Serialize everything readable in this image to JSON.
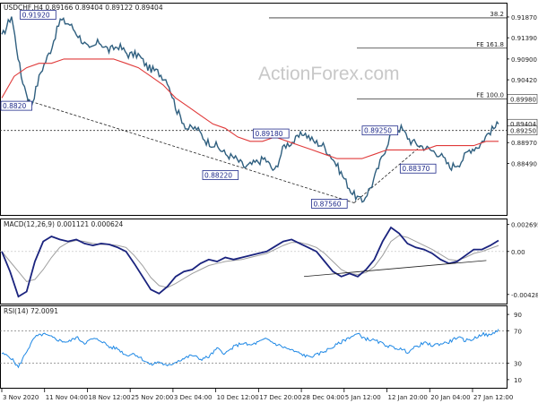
{
  "chart_data": [
    {
      "type": "candlestick",
      "header": "USDCHF,H4  0.89166 0.89404 0.89122 0.89404",
      "watermark": "ActionForex.com",
      "ylim": [
        0.873,
        0.922
      ],
      "yticks": [
        "0.91870",
        "0.91390",
        "0.90900",
        "0.90420",
        "0.89940",
        "0.89460",
        "0.88970",
        "0.88490"
      ],
      "ytick_values": [
        0.9187,
        0.9139,
        0.909,
        0.9042,
        0.8994,
        0.8946,
        0.8897,
        0.8849
      ],
      "hlines": [
        {
          "label": "38.2",
          "value": 0.9185
        },
        {
          "label": "FE 161.8",
          "value": 0.9115
        },
        {
          "label": "FE 100.0",
          "value": 0.8998,
          "tag": "0.89980"
        },
        {
          "label": "",
          "value": 0.8925,
          "tag": "0.89250",
          "dashed": true
        }
      ],
      "last_price_tag": "0.89404",
      "price_labels": [
        {
          "text": "0.91920",
          "x": 0.04,
          "y": 0.9192
        },
        {
          "text": "0.8820",
          "x": 0.0,
          "y": 0.8982
        },
        {
          "text": "0.89180",
          "x": 0.5,
          "y": 0.8918
        },
        {
          "text": "0.88220",
          "x": 0.4,
          "y": 0.8822
        },
        {
          "text": "0.89250",
          "x": 0.715,
          "y": 0.8925
        },
        {
          "text": "0.88370",
          "x": 0.79,
          "y": 0.8837
        },
        {
          "text": "0.87560",
          "x": 0.615,
          "y": 0.8756
        }
      ],
      "price_path": [
        0.914,
        0.919,
        0.905,
        0.898,
        0.906,
        0.911,
        0.918,
        0.917,
        0.914,
        0.911,
        0.913,
        0.911,
        0.912,
        0.91,
        0.91,
        0.907,
        0.906,
        0.904,
        0.897,
        0.893,
        0.893,
        0.89,
        0.889,
        0.887,
        0.886,
        0.884,
        0.885,
        0.886,
        0.883,
        0.889,
        0.89,
        0.892,
        0.89,
        0.889,
        0.886,
        0.882,
        0.878,
        0.876,
        0.88,
        0.886,
        0.892,
        0.893,
        0.89,
        0.889,
        0.888,
        0.887,
        0.884,
        0.885,
        0.888,
        0.889,
        0.892,
        0.894
      ],
      "ma_path": [
        0.9,
        0.905,
        0.907,
        0.908,
        0.908,
        0.909,
        0.909,
        0.909,
        0.909,
        0.909,
        0.908,
        0.907,
        0.905,
        0.903,
        0.9,
        0.898,
        0.896,
        0.894,
        0.893,
        0.891,
        0.89,
        0.89,
        0.891,
        0.89,
        0.889,
        0.888,
        0.887,
        0.886,
        0.886,
        0.886,
        0.887,
        0.888,
        0.888,
        0.888,
        0.888,
        0.889,
        0.889,
        0.889,
        0.889,
        0.89,
        0.89
      ]
    },
    {
      "type": "line",
      "header": "MACD(12,26,9) 0.001121 0.000624",
      "ylim": [
        -0.0052,
        0.0032
      ],
      "yticks": [
        "0.002695",
        "0.00",
        "-0.004289"
      ],
      "ytick_values": [
        0.002695,
        0.0,
        -0.004289
      ],
      "series": [
        {
          "values": [
            0.0,
            -0.002,
            -0.0045,
            -0.004,
            -0.001,
            0.001,
            0.0015,
            0.0012,
            0.001,
            0.0012,
            0.0008,
            0.0006,
            0.0008,
            0.0007,
            0.0004,
            0.0,
            -0.0012,
            -0.0025,
            -0.0038,
            -0.0042,
            -0.0035,
            -0.0025,
            -0.002,
            -0.0018,
            -0.0012,
            -0.0008,
            -0.001,
            -0.0006,
            -0.0008,
            -0.0006,
            -0.0004,
            -0.0002,
            0.0,
            0.0005,
            0.001,
            0.0012,
            0.0008,
            0.0004,
            0.0,
            -0.001,
            -0.002,
            -0.0025,
            -0.0022,
            -0.0025,
            -0.0018,
            -0.0008,
            0.001,
            0.0024,
            0.0018,
            0.0008,
            0.0004,
            0.0002,
            -0.0002,
            -0.0008,
            -0.0012,
            -0.001,
            -0.0004,
            0.0002,
            0.0002,
            0.0006,
            0.0011
          ]
        },
        {
          "values": [
            0.0,
            -0.001,
            -0.002,
            -0.003,
            -0.0028,
            -0.0018,
            -0.0006,
            0.0004,
            0.0009,
            0.0011,
            0.001,
            0.0008,
            0.0007,
            0.0007,
            0.0006,
            0.0004,
            -0.0004,
            -0.0014,
            -0.0026,
            -0.0034,
            -0.0036,
            -0.0032,
            -0.0027,
            -0.0022,
            -0.0018,
            -0.0014,
            -0.0012,
            -0.001,
            -0.0009,
            -0.0008,
            -0.0006,
            -0.0004,
            -0.0002,
            0.0002,
            0.0006,
            0.0009,
            0.0009,
            0.0007,
            0.0004,
            -0.0002,
            -0.001,
            -0.0018,
            -0.0022,
            -0.0023,
            -0.0021,
            -0.0015,
            -0.0004,
            0.001,
            0.0016,
            0.0014,
            0.001,
            0.0006,
            0.0002,
            -0.0003,
            -0.0008,
            -0.0009,
            -0.0006,
            -0.0002,
            0.0,
            0.0003,
            0.0006
          ]
        }
      ],
      "trendline": {
        "x": [
          0.6,
          0.96
        ],
        "y": [
          -0.0025,
          -0.0009
        ]
      }
    },
    {
      "type": "line",
      "header": "RSI(14) 72.0091",
      "ylim": [
        0,
        100
      ],
      "yticks": [
        "90",
        "70",
        "30",
        "10"
      ],
      "ytick_values": [
        90,
        70,
        30,
        10
      ],
      "series": [
        {
          "values": [
            42,
            38,
            25,
            45,
            62,
            66,
            62,
            58,
            56,
            62,
            55,
            60,
            58,
            50,
            48,
            40,
            42,
            35,
            28,
            32,
            26,
            32,
            36,
            40,
            35,
            38,
            48,
            42,
            50,
            55,
            52,
            56,
            60,
            54,
            50,
            46,
            42,
            38,
            40,
            45,
            50,
            56,
            62,
            66,
            60,
            58,
            54,
            50,
            48,
            44,
            50,
            55,
            52,
            54,
            56,
            62,
            58,
            60,
            66,
            64,
            72
          ]
        }
      ]
    }
  ],
  "x_axis": {
    "labels": [
      "3 Nov 2020",
      "11 Nov 04:00",
      "18 Nov 12:00",
      "25 Nov 20:00",
      "3 Dec 04:00",
      "10 Dec 12:00",
      "17 Dec 20:00",
      "28 Dec 04:00",
      "5 Jan 12:00",
      "12 Jan 20:00",
      "20 Jan 04:00",
      "27 Jan 12:00"
    ]
  },
  "colors": {
    "price": "#2f5f7f",
    "ma": "#e03a3a",
    "macd": "#1a237e",
    "signal": "#9e9e9e",
    "rsi": "#1e88e5",
    "grid_dash": "#555555",
    "level": "#333333"
  }
}
